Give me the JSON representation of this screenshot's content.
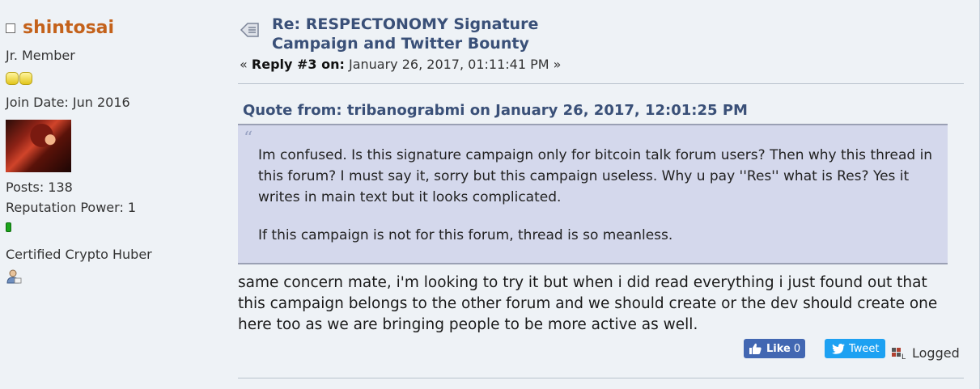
{
  "poster": {
    "username": "shintosai",
    "rank": "Jr. Member",
    "star_count": 2,
    "join_date": "Join Date: Jun 2016",
    "posts": "Posts: 138",
    "reputation": "Reputation Power: 1",
    "custom_title": "Certified Crypto Huber"
  },
  "post": {
    "subject": "Re: RESPECTONOMY Signature Campaign and Twitter Bounty",
    "reply_prefix": "«",
    "reply_label": "Reply #3 on:",
    "reply_date": "January 26, 2017, 01:11:41 PM",
    "reply_suffix": "»",
    "quote": {
      "header": "Quote from: tribanograbmi on January 26, 2017, 12:01:25 PM",
      "paragraph1": "Im confused. Is this signature campaign only for bitcoin talk forum users? Then why this thread in this forum? I must say it, sorry but this campaign useless. Why u pay ''Res'' what is Res? Yes it writes in main text but it looks complicated.",
      "paragraph2": "If this campaign is not for this forum, thread is so meanless."
    },
    "body": "same concern mate, i'm looking to try it but when i did read everything i just found out that this campaign belongs to the other forum and we should create or the dev should create one here too as we are bringing people to be more active as well."
  },
  "actions": {
    "like_label": "Like",
    "like_count": "0",
    "tweet_label": "Tweet",
    "logged_label": "Logged"
  },
  "colors": {
    "username": "#c4621b",
    "subject": "#3a5078",
    "quote_bg": "#d4d8ec",
    "like_bg": "#4267b2",
    "tweet_bg": "#1da1f2",
    "reputation": "#1da51d"
  }
}
